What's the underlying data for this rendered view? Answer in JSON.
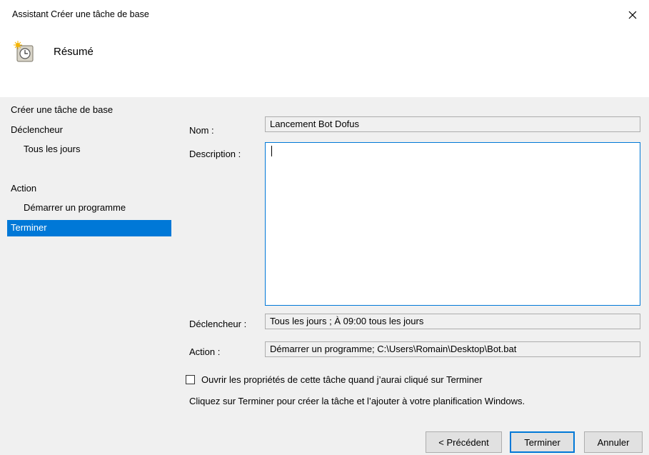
{
  "window": {
    "title": "Assistant Créer une tâche de base",
    "close_glyph": "✕"
  },
  "header": {
    "title": "Résumé",
    "icon": "task-clock-icon"
  },
  "nav": {
    "items": [
      {
        "label": "Créer une tâche de base"
      },
      {
        "label": "Déclencheur"
      },
      {
        "label": "Tous les jours"
      },
      {
        "label": "Action"
      },
      {
        "label": "Démarrer un programme"
      },
      {
        "label": "Terminer",
        "selected": true
      }
    ]
  },
  "form": {
    "name_label": "Nom :",
    "name_value": "Lancement Bot Dofus",
    "description_label": "Description :",
    "description_value": "",
    "trigger_label": "Déclencheur :",
    "trigger_value": "Tous les jours ; À 09:00 tous les jours",
    "action_label": "Action :",
    "action_value": "Démarrer un programme; C:\\Users\\Romain\\Desktop\\Bot.bat"
  },
  "options": {
    "open_properties_label": "Ouvrir les propriétés de cette tâche quand j’aurai cliqué sur Terminer",
    "open_properties_checked": false,
    "info_text": "Cliquez sur Terminer pour créer la tâche et l’ajouter à votre planification Windows."
  },
  "buttons": {
    "back": "< Précédent",
    "finish": "Terminer",
    "cancel": "Annuler"
  },
  "colors": {
    "accent": "#0078d7",
    "dialog_bg": "#f0f0f0",
    "header_bg": "#ffffff"
  }
}
